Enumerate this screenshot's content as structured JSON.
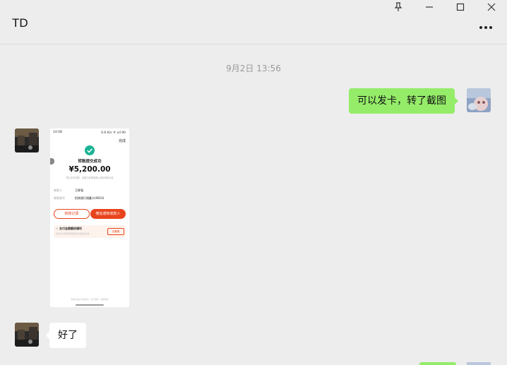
{
  "window": {
    "title": "TD",
    "pin_icon": "pin-icon",
    "minimize_icon": "minimize-icon",
    "maximize_icon": "maximize-icon",
    "close_icon": "close-icon",
    "more_icon": "more-icon"
  },
  "messages": {
    "timestamp": "9月2日 13:56",
    "outgoing_1": "可以发卡，转了截图",
    "incoming_reply": "好了"
  },
  "screenshot": {
    "status_time": "14:08",
    "status_right": "0.6 K/s ᯤ ull 90",
    "top_right": "完成",
    "status_title": "转账提交成功",
    "amount": "¥5,200.00",
    "note": "预计实时到账，由银行处理结果以实际到账为准",
    "payee_label": "收款人",
    "payee_value": "王辉强",
    "bank_label": "收款账号",
    "bank_value": "招商银行储蓄卡(9810)",
    "btn_record": "转账记录",
    "btn_notify": "微信通知收款人",
    "promo_title": "☆ 支付金额翻倍福利",
    "promo_sub": "使用支付宝转账领取额外奖励福利优惠",
    "promo_btn": "去看看",
    "footer": "本服务由支付宝提供 · 安全保障 · 客服帮助"
  },
  "colors": {
    "background": "#ededed",
    "green_bubble": "#95ec69",
    "success_teal": "#1ab394",
    "notify_red": "#e8441c"
  }
}
